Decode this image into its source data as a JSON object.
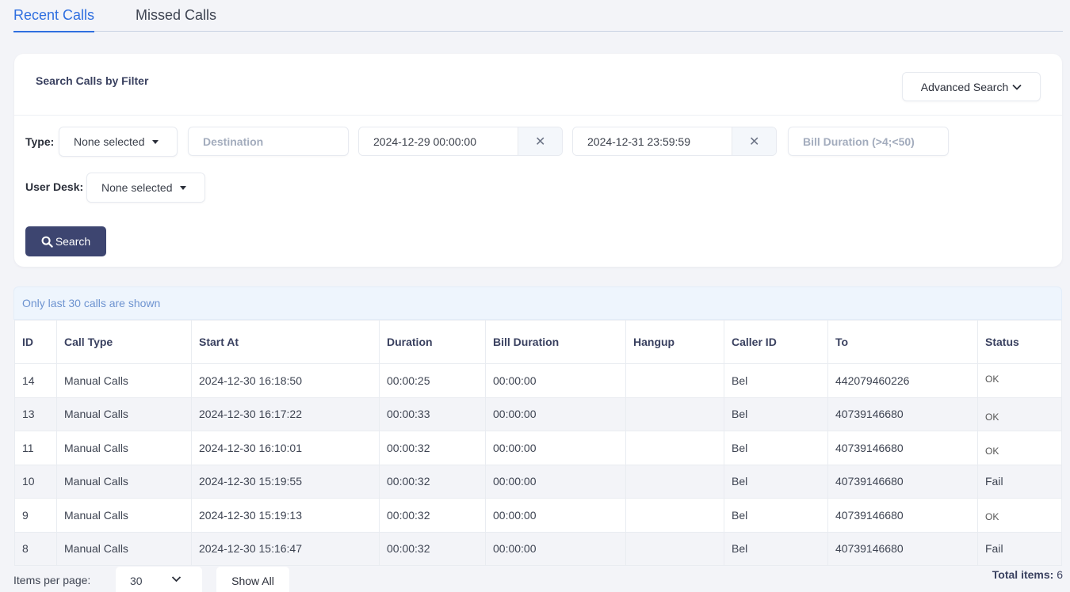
{
  "tabs": [
    {
      "label": "Recent Calls",
      "active": true
    },
    {
      "label": "Missed Calls",
      "active": false
    }
  ],
  "filter_card": {
    "title": "Search Calls by Filter",
    "advanced_search_label": "Advanced Search",
    "type_label": "Type:",
    "type_value": "None selected",
    "destination_placeholder": "Destination",
    "date_from": "2024-12-29 00:00:00",
    "date_to": "2024-12-31 23:59:59",
    "clear_glyph": "✕",
    "bill_duration_placeholder": "Bill Duration (>4;<50)",
    "user_desk_label": "User Desk:",
    "user_desk_value": "None selected",
    "search_label": "Search"
  },
  "notice": "Only last 30 calls are shown",
  "table": {
    "headers": [
      "ID",
      "Call Type",
      "Start At",
      "Duration",
      "Bill Duration",
      "Hangup",
      "Caller ID",
      "To",
      "Status"
    ],
    "rows": [
      {
        "id": "14",
        "call_type": "Manual Calls",
        "start_at": "2024-12-30 16:18:50",
        "duration": "00:00:25",
        "bill_duration": "00:00:00",
        "hangup": "",
        "caller_id": "Bel",
        "to": "442079460226",
        "status": "OK"
      },
      {
        "id": "13",
        "call_type": "Manual Calls",
        "start_at": "2024-12-30 16:17:22",
        "duration": "00:00:33",
        "bill_duration": "00:00:00",
        "hangup": "",
        "caller_id": "Bel",
        "to": "40739146680",
        "status": "OK"
      },
      {
        "id": "11",
        "call_type": "Manual Calls",
        "start_at": "2024-12-30 16:10:01",
        "duration": "00:00:32",
        "bill_duration": "00:00:00",
        "hangup": "",
        "caller_id": "Bel",
        "to": "40739146680",
        "status": "OK"
      },
      {
        "id": "10",
        "call_type": "Manual Calls",
        "start_at": "2024-12-30 15:19:55",
        "duration": "00:00:32",
        "bill_duration": "00:00:00",
        "hangup": "",
        "caller_id": "Bel",
        "to": "40739146680",
        "status": "Fail"
      },
      {
        "id": "9",
        "call_type": "Manual Calls",
        "start_at": "2024-12-30 15:19:13",
        "duration": "00:00:32",
        "bill_duration": "00:00:00",
        "hangup": "",
        "caller_id": "Bel",
        "to": "40739146680",
        "status": "OK"
      },
      {
        "id": "8",
        "call_type": "Manual Calls",
        "start_at": "2024-12-30 15:16:47",
        "duration": "00:00:32",
        "bill_duration": "00:00:00",
        "hangup": "",
        "caller_id": "Bel",
        "to": "40739146680",
        "status": "Fail"
      }
    ]
  },
  "pagination": {
    "items_per_page_label": "Items per page:",
    "items_per_page_value": "30",
    "show_all_label": "Show All",
    "total_label": "Total items:",
    "total_value": "6"
  },
  "colors": {
    "accent": "#2f6fe0",
    "search_button": "#3d4570",
    "notice_text": "#6d93d0"
  }
}
